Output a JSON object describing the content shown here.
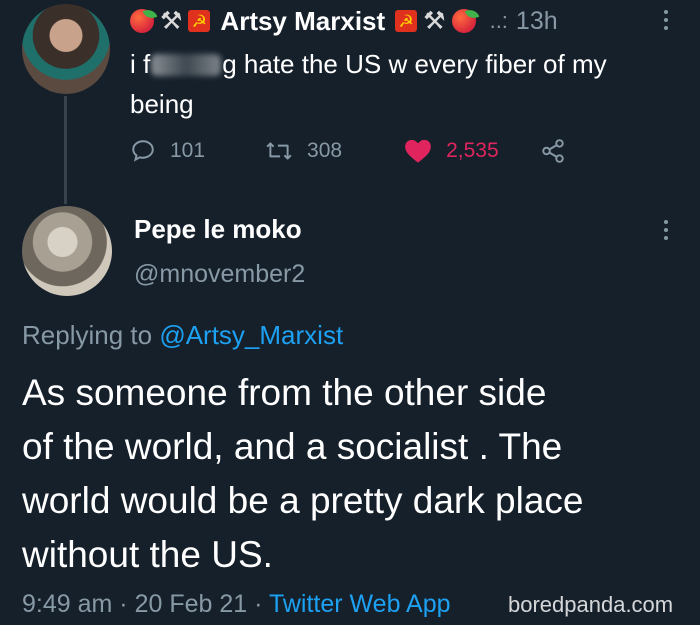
{
  "original_tweet": {
    "display_name": "Artsy Marxist",
    "time": "13h",
    "time_prefix": "..:",
    "text_start": "i f",
    "text_end": "g hate the US w every fiber of my",
    "text_line2": "being",
    "replies": "101",
    "retweets": "308",
    "likes": "2,535",
    "icons": [
      "mango-emoji",
      "hammer-pick-emoji",
      "soviet-flag-emoji",
      "reply-icon",
      "retweet-icon",
      "heart-icon",
      "share-icon",
      "more-icon"
    ]
  },
  "reply_tweet": {
    "display_name": "Pepe le moko",
    "handle": "@mnovember2",
    "replying_label": "Replying to",
    "replying_to": "@Artsy_Marxist",
    "text_line1": "As someone from the other side",
    "text_line2": "of the world, and a socialist . The",
    "text_line3": "world would be a pretty dark place",
    "text_line4": "without the US.",
    "time": "9:49 am",
    "date": "20 Feb 21",
    "source": "Twitter Web App",
    "separator": "·"
  },
  "watermark": "boredpanda.com",
  "colors": {
    "background": "#15202b",
    "text": "#ffffff",
    "muted": "#8899a6",
    "accent": "#1da1f2",
    "like": "#e0245e"
  }
}
